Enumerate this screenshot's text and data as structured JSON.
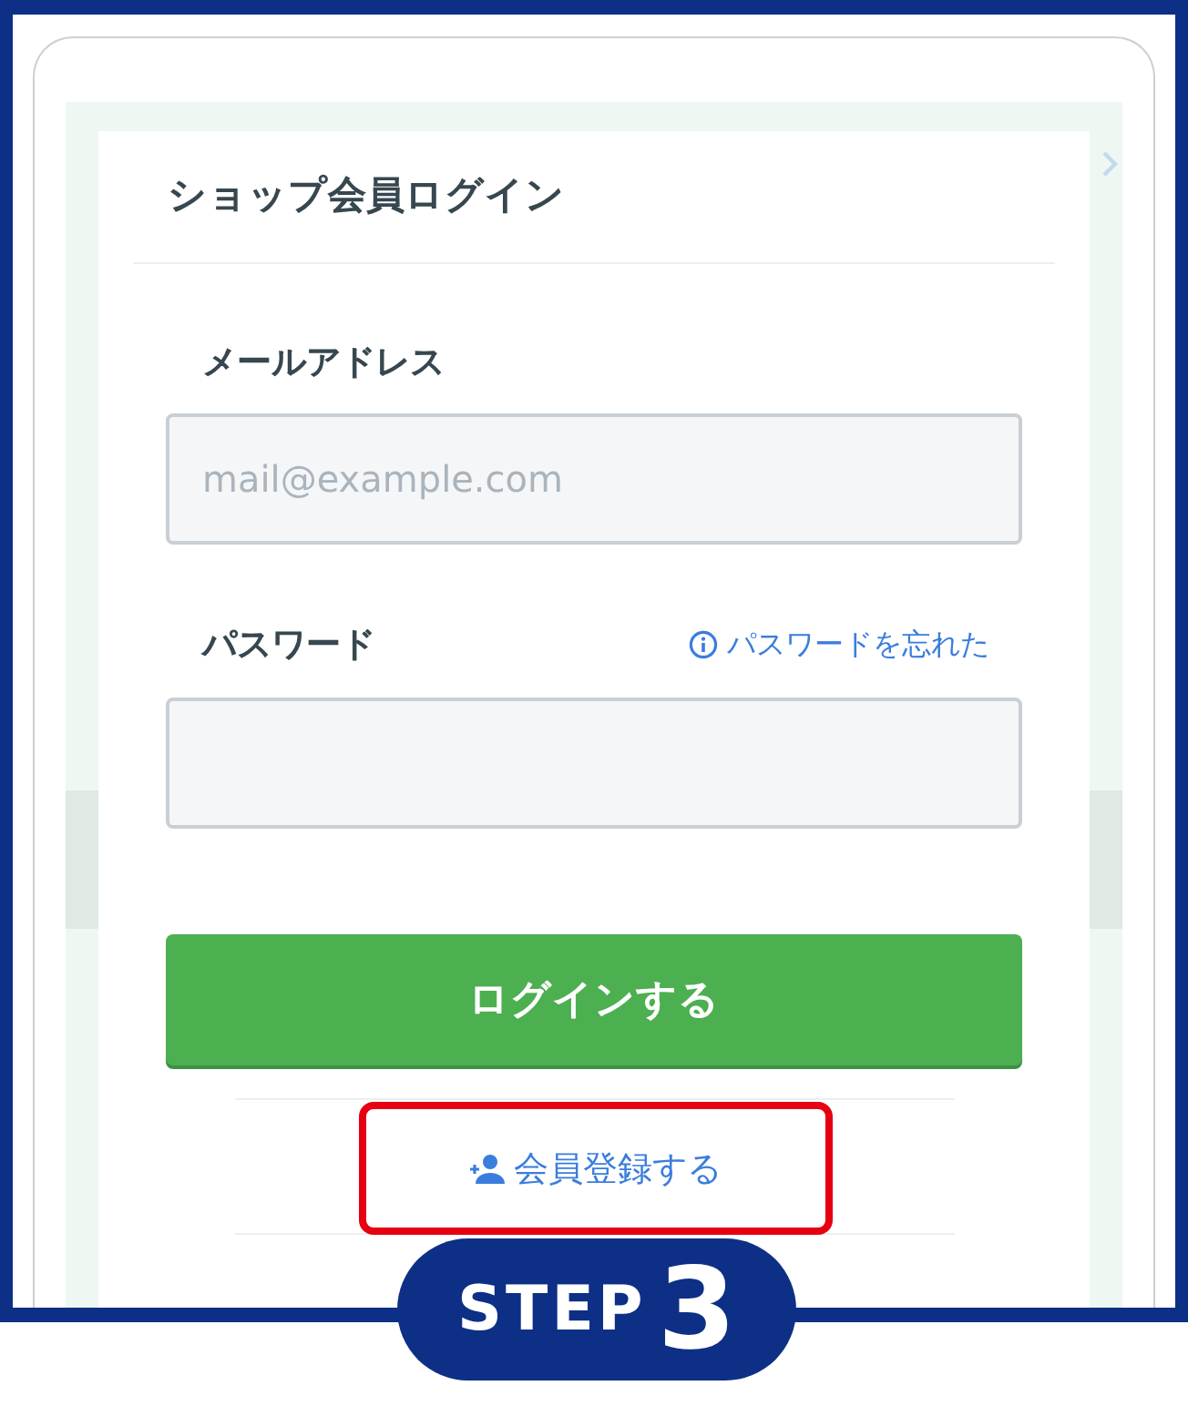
{
  "title": "ショップ会員ログイン",
  "fields": [
    {
      "label": "メールアドレス",
      "placeholder": "mail@example.com"
    },
    {
      "label": "パスワード",
      "link": "パスワードを忘れた"
    }
  ],
  "login_button": "ログインする",
  "register_link": {
    "label": "会員登録する",
    "highlighted": true
  },
  "step_badge": {
    "label": "STEP",
    "number": "3"
  }
}
